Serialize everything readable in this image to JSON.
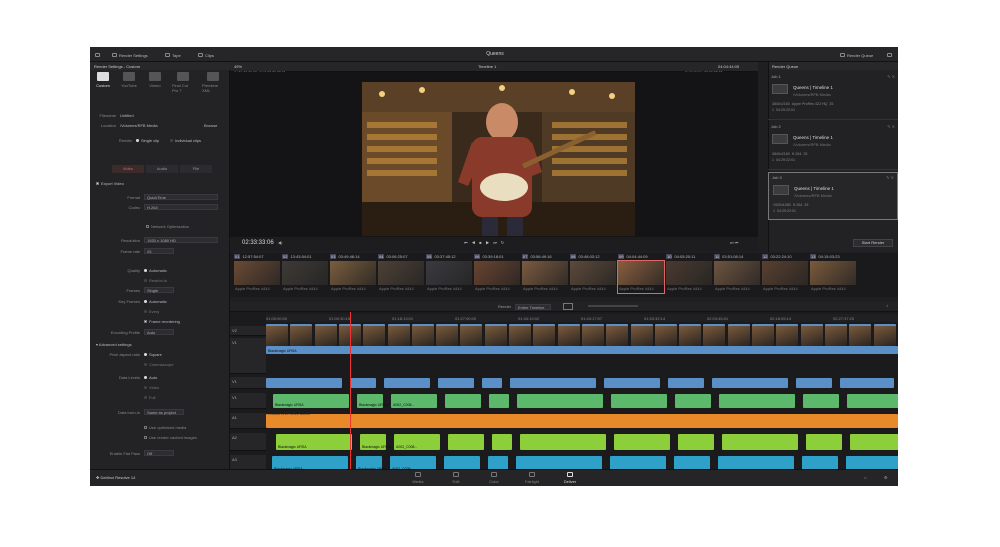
{
  "topbar": {
    "render_settings": "Render Settings",
    "tape": "Tape",
    "clips": "Clips",
    "project_title": "Queens",
    "render_queue": "Render Queue"
  },
  "left_panel": {
    "header": "Render Settings - Custom",
    "presets": [
      "Custom",
      "YouTube",
      "Vimeo",
      "Final Cut Pro 7",
      "Premiere XML"
    ],
    "filename_label": "Filename",
    "filename_value": "Untitled",
    "location_label": "Location",
    "location_value": "/Volumes/RFB Media",
    "browse": "Browse",
    "render_label": "Render",
    "render_options": [
      "Single clip",
      "Individual clips"
    ],
    "tabs": [
      "Video",
      "Audio",
      "File"
    ],
    "export_video": "Export Video",
    "format_label": "Format",
    "format_value": "QuickTime",
    "codec_label": "Codec",
    "codec_value": "H.264",
    "network_opt": "Network Optimization",
    "resolution_label": "Resolution",
    "resolution_value": "1920 x 1080 HD",
    "framerate_label": "Frame rate",
    "framerate_value": "25",
    "quality_label": "Quality",
    "quality_options": [
      "Automatic",
      "Restrict to"
    ],
    "frames_label": "Frames",
    "frames_value": "Single",
    "keyframes_label": "Key Frames",
    "keyframes_options": [
      "Automatic",
      "Every",
      "Frame reordering"
    ],
    "encoding_label": "Encoding Profile",
    "encoding_value": "Auto",
    "advanced": "Advanced settings",
    "pixel_aspect_label": "Pixel aspect ratio",
    "pixel_aspect_options": [
      "Square",
      "Cinemascope"
    ],
    "data_levels_label": "Data Levels",
    "data_levels_options": [
      "Auto",
      "Video",
      "Full"
    ],
    "data_burn_label": "Data burn-in",
    "data_burn_value": "Same as project",
    "optimized_media": "Use optimized media",
    "render_cached": "Use render cached images",
    "flat_pass_label": "Enable Flat Pass",
    "flat_pass_value": "Off",
    "add_button": "Add to Render Queue"
  },
  "viewer": {
    "zoom": "49%",
    "timeline_name": "Timeline 1",
    "timecode_top": "04:04:44:05",
    "in_label": "IN",
    "in_value": "01:00:00:00",
    "out_label": "OUT",
    "out_value": "03:29:22:01",
    "duration_label": "DURATION",
    "duration_value": "02:29:22:02",
    "timecode": "02:33:33:06"
  },
  "render_queue": {
    "jobs": [
      {
        "id": "Job 1",
        "name": "Queens | Timeline 1",
        "path": "/Volumes/RFB Media",
        "meta": [
          "3840x2160",
          "Apple ProRes 422 HQ",
          "25",
          "1",
          "04:29:22:01"
        ]
      },
      {
        "id": "Job 2",
        "name": "Queens | Timeline 1",
        "path": "/Volumes/RFB Media",
        "meta": [
          "3840x2160",
          "H.264",
          "25",
          "1",
          "04:29:22:01"
        ]
      },
      {
        "id": "Job 3",
        "name": "Queens | Timeline 1",
        "path": "/Volumes/RFB Media",
        "meta": [
          "1920x1080",
          "H.264",
          "25",
          "1",
          "04:29:22:01"
        ]
      }
    ],
    "start_render": "Start Render"
  },
  "clips": [
    {
      "n": "01",
      "tc": "12:57:54:07",
      "codec": "Apple ProRes 4444"
    },
    {
      "n": "02",
      "tc": "13:43:54:01",
      "codec": "Apple ProRes 4444"
    },
    {
      "n": "03",
      "tc": "03:49:46:14",
      "codec": "Apple ProRes 4444"
    },
    {
      "n": "04",
      "tc": "03:06:25:07",
      "codec": "Apple ProRes 4444"
    },
    {
      "n": "05",
      "tc": "03:37:45:12",
      "codec": "Apple ProRes 4444"
    },
    {
      "n": "06",
      "tc": "03:39:18:01",
      "codec": "Apple ProRes 4444"
    },
    {
      "n": "07",
      "tc": "03:56:49:16",
      "codec": "Apple ProRes 4444"
    },
    {
      "n": "08",
      "tc": "03:48:03:12",
      "codec": "Apple ProRes 4444"
    },
    {
      "n": "09",
      "tc": "04:04:44:09",
      "codec": "Apple ProRes 4444"
    },
    {
      "n": "10",
      "tc": "04:05:20:11",
      "codec": "Apple ProRes 4444"
    },
    {
      "n": "11",
      "tc": "03:51:08:14",
      "codec": "Apple ProRes 4444"
    },
    {
      "n": "12",
      "tc": "03:22:24:10",
      "codec": "Apple ProRes 4444"
    },
    {
      "n": "13",
      "tc": "04:15:03:23",
      "codec": "Apple ProRes 4444"
    }
  ],
  "timeline": {
    "render_label": "Render",
    "render_value": "Entire Timeline",
    "ruler": [
      "01:00:00:00",
      "01:00:30:15",
      "01:18:13:01",
      "01:27:00:00",
      "01:34:19:02",
      "01:43:17:07",
      "01:53:32:14",
      "02:03:45:01",
      "02:18:05:14",
      "02:27:37:20"
    ],
    "tracks": [
      "V2",
      "V1",
      "A1",
      "A2",
      "A3",
      "A4",
      "A5",
      "A6"
    ],
    "audio_label": "KODAK LIVE REEL MIX01",
    "clip_labels": [
      "Blackmagic URSA",
      "Blackmagic URSA",
      "A002_C008..."
    ]
  },
  "pages": [
    "Media",
    "Edit",
    "Color",
    "Fairlight",
    "Deliver"
  ],
  "brand": "DaVinci Resolve 14",
  "colors": {
    "video": "#5b8fc7",
    "audio_green": "#5cb86a",
    "audio_orange": "#e8892a",
    "audio_lime": "#8ccf3a",
    "audio_teal": "#2fa0c8",
    "audio_pink": "#e89cc0",
    "accent": "#e04a4a"
  }
}
